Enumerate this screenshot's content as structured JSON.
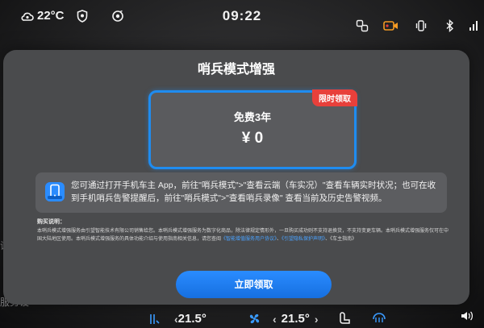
{
  "status_bar": {
    "outside_temp": "22°C",
    "clock": "09:22"
  },
  "modal": {
    "title": "哨兵模式增强",
    "offer": {
      "badge": "限时领取",
      "period": "免费3年",
      "price": "¥ 0"
    },
    "info_text": "您可通过打开手机车主 App，前往\"哨兵模式\">\"查看云端（车实况）\"查看车辆实时状况；也可在收到手机哨兵告警提醒后，前往\"哨兵模式\">\"查看哨兵录像\" 查看当前及历史告警视频。",
    "notes": {
      "title": "购买说明：",
      "line1": "本哨兵模式增强服务由引望智能技术有限公司销售给您。本哨兵模式增强服务为数字化商品，除法律规定情形外，一旦购买成功则不支持退换货，不支持变更车辆。本哨兵模式增强服务仅可在中",
      "line2": "国大陆地区使用。本哨兵模式增强服务的具体功能介绍与使用指南相关信息，请您查阅",
      "link1": "《智能增值服务用户协议》",
      "link2": "《引望隐私保护声明》",
      "link3": "《车主指南》",
      "connector": "、"
    },
    "claim_button": "立即领取"
  },
  "bottom_bar": {
    "left_temp": "21.5°",
    "right_temp": "21.5°"
  },
  "colors": {
    "accent": "#1f8cf0",
    "badge": "#e8403b",
    "modal_bg": "#4a4b4d"
  }
}
